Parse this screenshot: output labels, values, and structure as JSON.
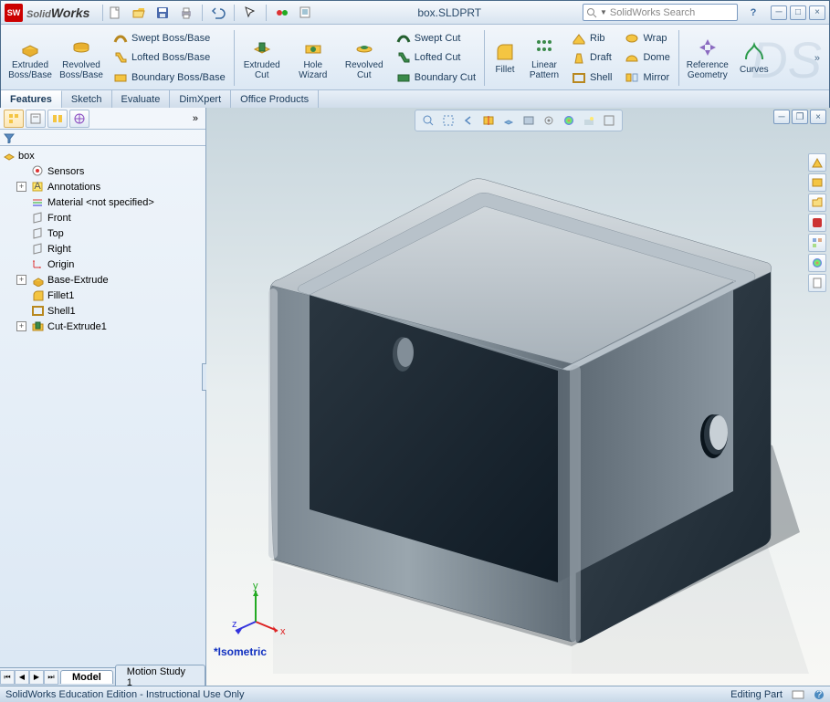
{
  "brand": "SolidWorks",
  "doc_title": "box.SLDPRT",
  "search_placeholder": "SolidWorks Search",
  "ribbon": {
    "extruded_boss": "Extruded Boss/Base",
    "revolved_boss": "Revolved Boss/Base",
    "swept_boss": "Swept Boss/Base",
    "lofted_boss": "Lofted Boss/Base",
    "boundary_boss": "Boundary Boss/Base",
    "extruded_cut": "Extruded Cut",
    "hole_wizard": "Hole Wizard",
    "revolved_cut": "Revolved Cut",
    "swept_cut": "Swept Cut",
    "lofted_cut": "Lofted Cut",
    "boundary_cut": "Boundary Cut",
    "fillet": "Fillet",
    "linear_pattern": "Linear Pattern",
    "rib": "Rib",
    "draft": "Draft",
    "shell": "Shell",
    "wrap": "Wrap",
    "dome": "Dome",
    "mirror": "Mirror",
    "ref_geom": "Reference Geometry",
    "curves": "Curves"
  },
  "tabs": {
    "features": "Features",
    "sketch": "Sketch",
    "evaluate": "Evaluate",
    "dimxpert": "DimXpert",
    "office": "Office Products"
  },
  "tree": {
    "root": "box",
    "sensors": "Sensors",
    "annotations": "Annotations",
    "material": "Material <not specified>",
    "front": "Front",
    "top": "Top",
    "right": "Right",
    "origin": "Origin",
    "base_extrude": "Base-Extrude",
    "fillet1": "Fillet1",
    "shell1": "Shell1",
    "cut_extrude1": "Cut-Extrude1"
  },
  "view_label": "*Isometric",
  "bottom_tabs": {
    "model": "Model",
    "motion": "Motion Study 1"
  },
  "status": {
    "left": "SolidWorks Education Edition - Instructional Use Only",
    "mode": "Editing Part"
  }
}
